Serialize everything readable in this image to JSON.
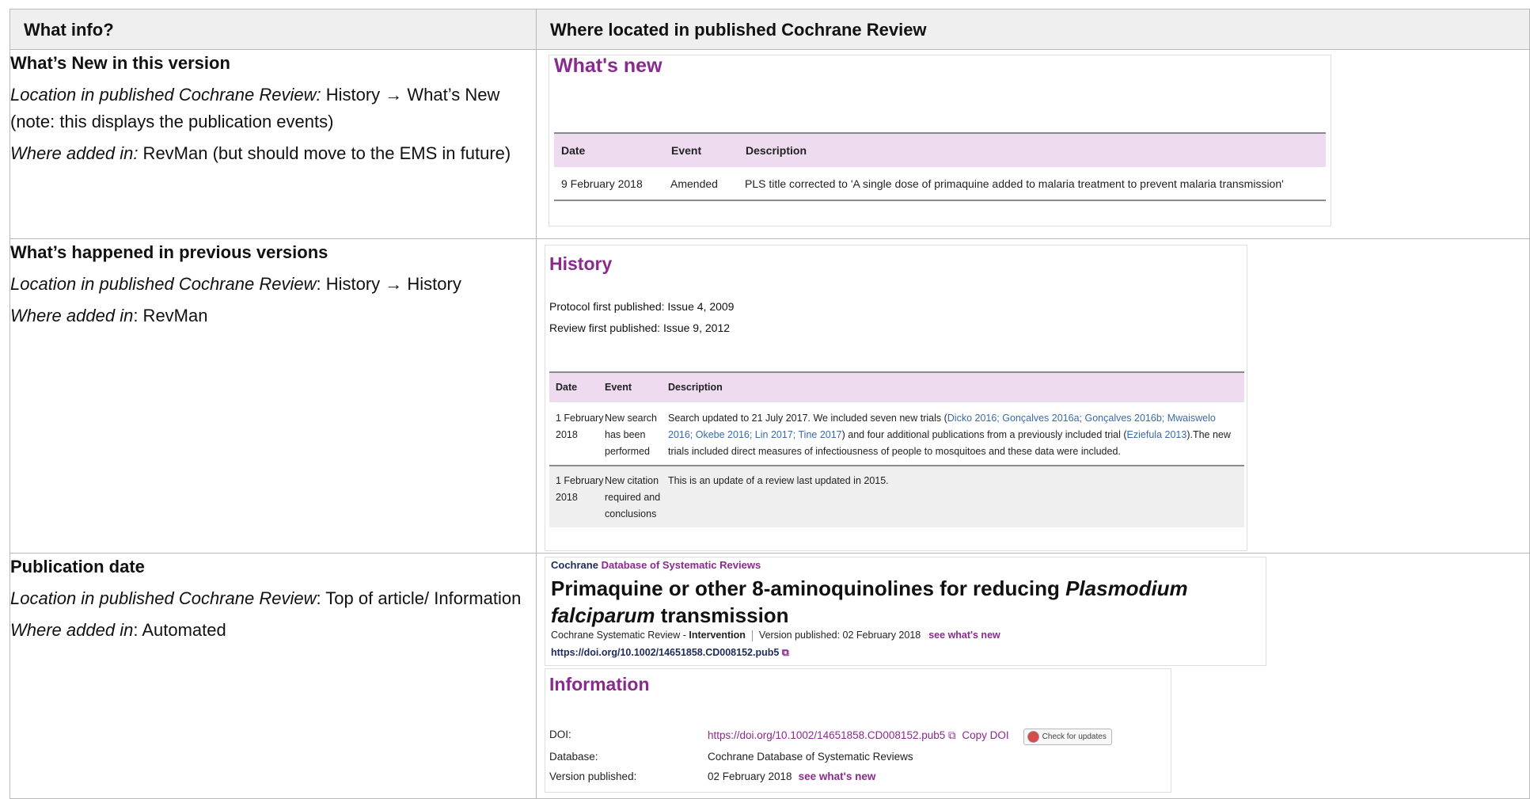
{
  "header": {
    "col1": "What info?",
    "col2": "Where located in published Cochrane Review"
  },
  "rows": [
    {
      "title": "What’s New in this version",
      "loc_label": "Location in published Cochrane Review:",
      "loc_value": " History → What’s New (note: this displays the publication events)",
      "added_label": "Where added in:",
      "added_value": " RevMan (but should move to the EMS in future)"
    },
    {
      "title": "What’s happened in previous versions",
      "loc_label": "Location in published Cochrane Review",
      "loc_value": ": History → History",
      "added_label": "Where added in",
      "added_value": ": RevMan"
    },
    {
      "title": "Publication date",
      "loc_label": "Location in published Cochrane Review",
      "loc_value": ": Top of article/ Information",
      "added_label": "Where added in",
      "added_value": ": Automated"
    }
  ],
  "whats_new": {
    "heading": "What's new",
    "cols": [
      "Date",
      "Event",
      "Description"
    ],
    "row": {
      "date": "9 February 2018",
      "event": "Amended",
      "desc": "PLS title corrected to 'A single dose of primaquine added to malaria treatment to prevent malaria transmission'"
    }
  },
  "history": {
    "heading": "History",
    "protocol": "Protocol first published: Issue 4, 2009",
    "review": "Review first published: Issue 9, 2012",
    "cols": [
      "Date",
      "Event",
      "Description"
    ],
    "r1": {
      "date": "1 February 2018",
      "event": "New search has been performed",
      "d_a": "Search updated to 21 July 2017. We included seven new trials (",
      "l1": "Dicko 2016; Gonçalves 2016a; Gonçalves 2016b; Mwaiswelo 2016; Okebe 2016; Lin 2017; Tine 2017",
      "d_b": ") and four additional publications from a previously included trial (",
      "l2": "Eziefula 2013",
      "d_c": ").The new trials included direct measures of infectiousness of people to mosquitoes and these data were included."
    },
    "r2": {
      "date": "1 February 2018",
      "event": "New citation required and conclusions",
      "desc": "This is an update of a review last updated in 2015."
    }
  },
  "article": {
    "brand": "Cochrane",
    "db": " Database of Systematic Reviews",
    "title_a": "Primaquine or other 8-aminoquinolines for reducing ",
    "title_i": "Plasmodium falciparum",
    "title_b": " transmission",
    "meta_type": "Cochrane Systematic Review - ",
    "meta_bold": "Intervention",
    "meta_pub": "Version published: 02 February 2018",
    "meta_link": "see what's new",
    "doi": "https://doi.org/10.1002/14651858.CD008152.pub5"
  },
  "info": {
    "heading": "Information",
    "doi_label": "DOI:",
    "doi_value": "https://doi.org/10.1002/14651858.CD008152.pub5",
    "copy": "Copy DOI",
    "check": "Check for updates",
    "db_label": "Database:",
    "db_value": "Cochrane Database of Systematic Reviews",
    "ver_label": "Version published:",
    "ver_value": "02 February 2018",
    "ver_link": "see what's new"
  },
  "colors": {
    "purple": "#8a2a8e",
    "lavender": "#efdbf0",
    "link_blue": "#3b6aa8"
  }
}
